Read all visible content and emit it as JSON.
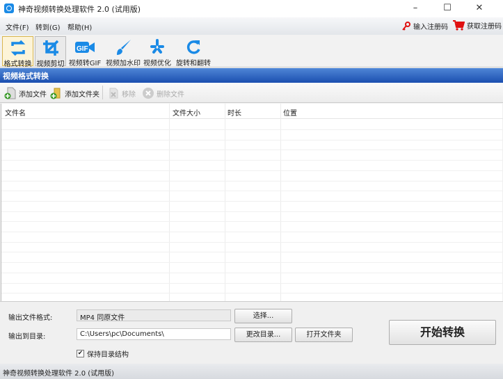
{
  "window": {
    "title": "神奇视频转换处理软件 2.0 (试用版)",
    "minimize": "–",
    "maximize": "☐",
    "close": "✕"
  },
  "menu": {
    "items": [
      "文件(F)",
      "转到(G)",
      "帮助(H)"
    ],
    "register": "输入注册码",
    "buy": "获取注册码"
  },
  "toolbar": {
    "items": [
      {
        "label": "格式转换",
        "icon": "convert-icon"
      },
      {
        "label": "视频剪切",
        "icon": "crop-icon"
      },
      {
        "label": "视频转GIF",
        "icon": "gif-icon"
      },
      {
        "label": "视频加水印",
        "icon": "brush-icon"
      },
      {
        "label": "视频优化",
        "icon": "optimize-icon"
      },
      {
        "label": "旋转和翻转",
        "icon": "rotate-icon"
      }
    ]
  },
  "header": {
    "title": "视频格式转换"
  },
  "actions": {
    "add_file": "添加文件",
    "add_folder": "添加文件夹",
    "remove": "移除",
    "delete": "删除文件"
  },
  "table": {
    "columns": [
      "文件名",
      "文件大小",
      "时长",
      "位置"
    ]
  },
  "output": {
    "format_label": "输出文件格式:",
    "format_value": "MP4 同原文件",
    "choose": "选择...",
    "dir_label": "输出到目录:",
    "dir_value": "C:\\Users\\pc\\Documents\\",
    "change_dir": "更改目录...",
    "open_folder": "打开文件夹",
    "keep_structure": "保持目录结构",
    "keep_checked": true,
    "start": "开始转换"
  },
  "status": {
    "text": "神奇视频转换处理软件 2.0 (试用版)"
  },
  "colors": {
    "accent": "#1a8ae6",
    "header": "#1b4fb0"
  }
}
